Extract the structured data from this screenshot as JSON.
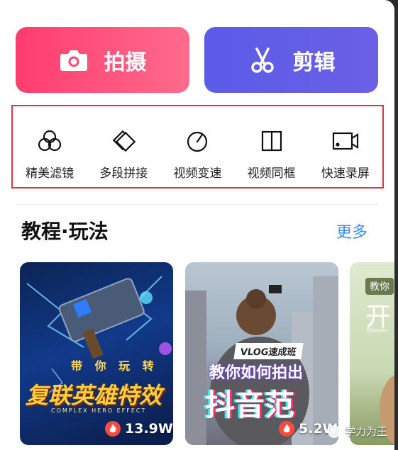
{
  "actions": {
    "shoot_label": "拍摄",
    "edit_label": "剪辑"
  },
  "tools": [
    {
      "label": "精美滤镜",
      "icon": "filter-icon"
    },
    {
      "label": "多段拼接",
      "icon": "splice-icon"
    },
    {
      "label": "视频变速",
      "icon": "speed-icon"
    },
    {
      "label": "视频同框",
      "icon": "duet-icon"
    },
    {
      "label": "快速录屏",
      "icon": "screen-record-icon"
    }
  ],
  "section": {
    "title": "教程·玩法",
    "more_label": "更多"
  },
  "cards": [
    {
      "line_top": "带 你 玩 转",
      "line_main": "复联英雄特效",
      "line_sub": "COMPLEX HERO EFFECT",
      "views": "13.9W"
    },
    {
      "tag": "VLOG速成班",
      "line1": "教你如何拍出",
      "line2": "抖音范",
      "views": "5.2W"
    },
    {
      "tag": "教你",
      "big": "开",
      "small": "Bloom"
    }
  ],
  "watermark": "学力为王",
  "colors": {
    "shoot_button": "#ff3c6e",
    "edit_button": "#5b5ce8",
    "more_link": "#3a8dff",
    "highlight_box": "#d9373c"
  }
}
